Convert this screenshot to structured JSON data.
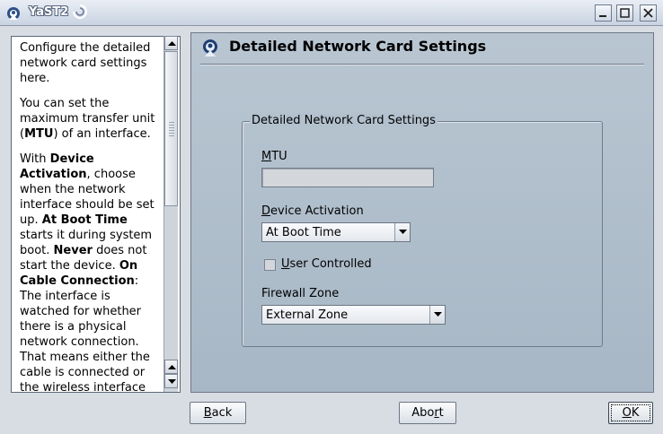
{
  "window": {
    "title": "YaST2"
  },
  "help": {
    "paragraphs": [
      [
        {
          "t": "Configure the detailed network card settings here."
        }
      ],
      [
        {
          "t": "You can set the maximum transfer unit ("
        },
        {
          "t": "MTU",
          "b": true
        },
        {
          "t": ") of an interface."
        }
      ],
      [
        {
          "t": "With "
        },
        {
          "t": "Device Activation",
          "b": true
        },
        {
          "t": ", choose when the network interface should be set up. "
        },
        {
          "t": "At Boot Time",
          "b": true
        },
        {
          "t": " starts it during system boot. "
        },
        {
          "t": "Never",
          "b": true
        },
        {
          "t": " does not start the device. "
        },
        {
          "t": "On Cable Connection",
          "b": true
        },
        {
          "t": ": The interface is watched for whether there is a physical network connection. That means either the cable is connected or the wireless interface can connect."
        }
      ]
    ]
  },
  "dialog": {
    "title": "Detailed Network Card Settings",
    "group_title": "Detailed Network Card Settings",
    "mtu": {
      "label_hot": "M",
      "label_rest": "TU",
      "value": ""
    },
    "device_activation": {
      "label_hot": "D",
      "label_rest": "evice Activation",
      "selected": "At Boot Time"
    },
    "user_controlled": {
      "label_hot": "U",
      "label_rest": "ser Controlled",
      "checked": false
    },
    "firewall_zone": {
      "label": "Firewall Zone",
      "selected": "External Zone"
    }
  },
  "buttons": {
    "back_hot": "B",
    "back_rest": "ack",
    "abort_pre": "Abo",
    "abort_hot": "r",
    "abort_post": "t",
    "ok_hot": "O",
    "ok_rest": "K"
  }
}
